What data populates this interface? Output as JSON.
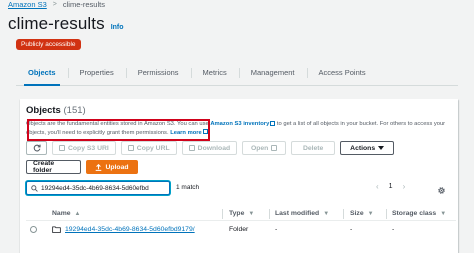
{
  "breadcrumb": {
    "root": "Amazon S3",
    "separator": ">",
    "current": "clime-results"
  },
  "bucket": {
    "title": "clime-results",
    "info_label": "Info",
    "access_badge": "Publicly accessible"
  },
  "tabs": [
    {
      "label": "Objects",
      "active": true
    },
    {
      "label": "Properties",
      "active": false
    },
    {
      "label": "Permissions",
      "active": false
    },
    {
      "label": "Metrics",
      "active": false
    },
    {
      "label": "Management",
      "active": false
    },
    {
      "label": "Access Points",
      "active": false
    }
  ],
  "objects": {
    "title": "Objects",
    "count": "(151)",
    "description_part1": "Objects are the fundamental entities stored in Amazon S3. You can use",
    "inventory_link": "Amazon S3 inventory",
    "description_part2": "to get a list of all objects in your bucket. For others to access your objects, you'll need to explicitly grant them permissions.",
    "learn_more": "Learn more"
  },
  "toolbar": {
    "copy_s3_uri": "Copy S3 URI",
    "copy_url": "Copy URL",
    "download": "Download",
    "open": "Open",
    "delete": "Delete",
    "actions": "Actions",
    "create_folder": "Create folder",
    "upload": "Upload"
  },
  "search": {
    "value": "19294ed4-35dc-4b69-8634-5d60efbd",
    "match_text": "1 match"
  },
  "pagination": {
    "current_page": "1"
  },
  "table": {
    "headers": {
      "name": "Name",
      "type": "Type",
      "last_modified": "Last modified",
      "size": "Size",
      "storage_class": "Storage class"
    },
    "rows": [
      {
        "name": "19294ed4-35dc-4b69-8634-5d60efbd9179/",
        "type": "Folder",
        "last_modified": "-",
        "size": "-",
        "storage_class": "-"
      }
    ]
  },
  "colors": {
    "accent": "#0073bb",
    "primary_button": "#ec7211",
    "badge": "#d13212",
    "highlight_box": "#d0021b"
  }
}
